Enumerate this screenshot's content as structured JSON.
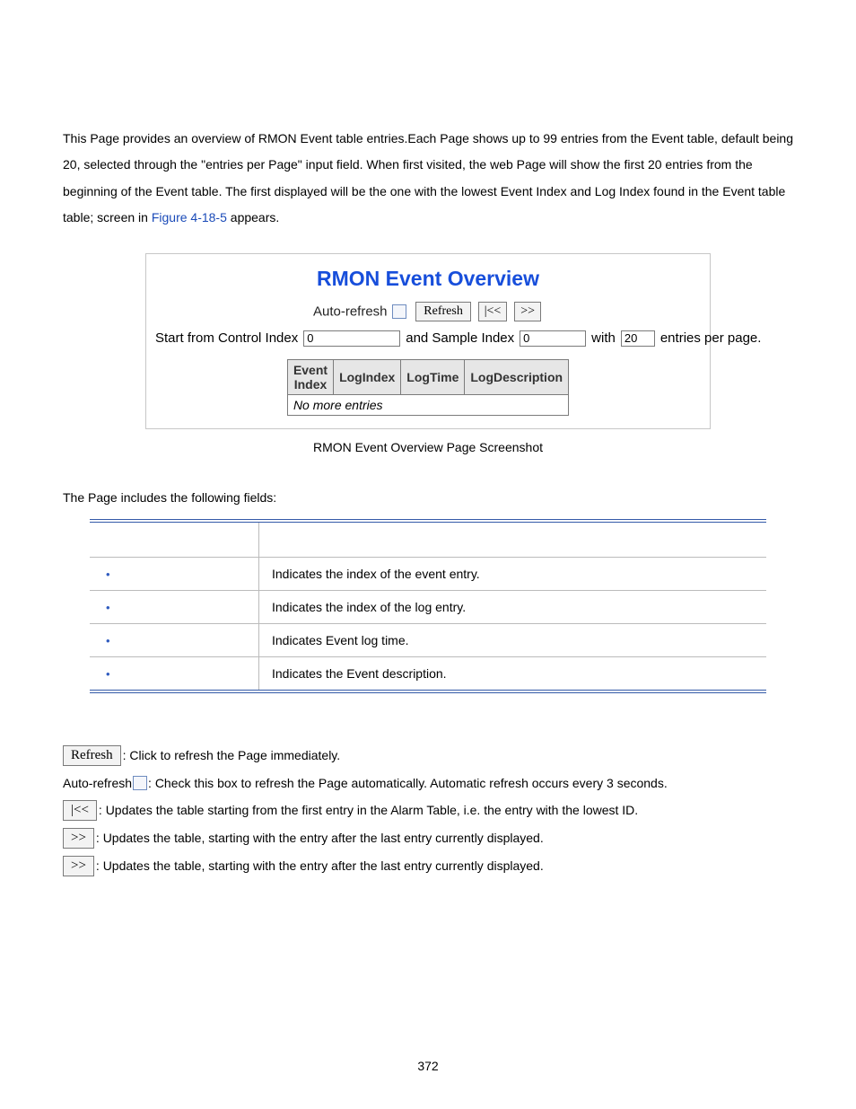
{
  "intro": {
    "line1": "This Page provides an overview of RMON Event table entries.Each Page shows up to 99 entries from the Event table, default being 20, selected through the \"entries per Page\" input field. When first visited, the web Page will show the first 20 entries from the beginning of the Event table. The first displayed will be the one with the lowest Event Index and Log Index found in the Event table table; screen in ",
    "figlink": "Figure 4-18-5",
    "line1_tail": " appears."
  },
  "screenshot": {
    "title": "RMON Event Overview",
    "autorefresh_label": "Auto-refresh",
    "refresh_btn": "Refresh",
    "first_btn": "|<<",
    "next_btn": ">>",
    "ctrl_label1": "Start from Control Index",
    "ctrl_value1": "0",
    "ctrl_label2": "and Sample Index",
    "ctrl_value2": "0",
    "ctrl_label3": "with",
    "ctrl_value3": "20",
    "ctrl_label4": "entries per page.",
    "th_event_index_l1": "Event",
    "th_event_index_l2": "Index",
    "th_logindex": "LogIndex",
    "th_logtime": "LogTime",
    "th_logdesc": "LogDescription",
    "no_entries": "No more entries"
  },
  "caption": "RMON Event Overview Page Screenshot",
  "fields_intro": "The Page includes the following fields:",
  "fields_table": {
    "col_obj": "",
    "col_desc": "",
    "rows": [
      {
        "obj": "",
        "desc": "Indicates the index of the event entry."
      },
      {
        "obj": "",
        "desc": "Indicates the index of the log entry."
      },
      {
        "obj": "",
        "desc": "Indicates Event log time."
      },
      {
        "obj": "",
        "desc": "Indicates the Event description."
      }
    ]
  },
  "buttons_expl": {
    "refresh_btn": "Refresh",
    "refresh_desc": ": Click to refresh the Page immediately.",
    "autorefresh_label": "Auto-refresh ",
    "autorefresh_desc": ": Check this box to refresh the Page automatically. Automatic refresh occurs every 3 seconds.",
    "first_btn": "|<<",
    "first_desc": ": Updates the table starting from the first entry in the Alarm Table, i.e. the entry with the lowest ID.",
    "next_btn1": ">>",
    "next_desc1": ": Updates the table, starting with the entry after the last entry currently displayed.",
    "next_btn2": ">>",
    "next_desc2": ": Updates the table, starting with the entry after the last entry currently displayed."
  },
  "page_number": "372"
}
